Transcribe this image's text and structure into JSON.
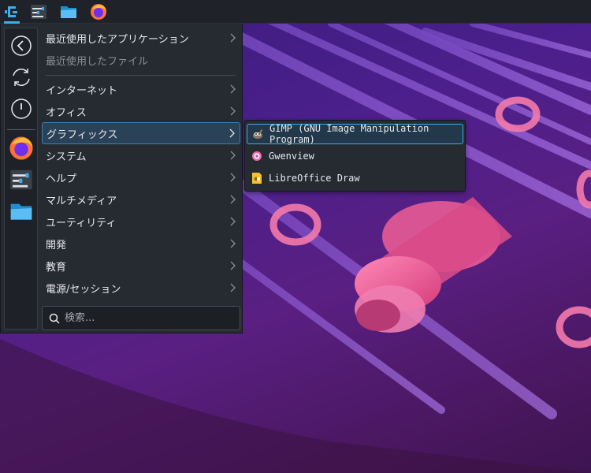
{
  "taskbar": {
    "launcher_icon": "application-launcher-icon",
    "apps": [
      {
        "name": "system-settings-icon"
      },
      {
        "name": "file-manager-icon"
      },
      {
        "name": "firefox-icon"
      }
    ]
  },
  "favorites": {
    "actions": [
      "back-icon",
      "refresh-icon",
      "power-icon"
    ],
    "apps": [
      "firefox-icon",
      "system-settings-icon",
      "file-manager-icon"
    ]
  },
  "menu": {
    "recent_apps": "最近使用したアプリケーション",
    "recent_files": "最近使用したファイル",
    "categories": [
      {
        "label": "インターネット"
      },
      {
        "label": "オフィス"
      },
      {
        "label": "グラフィックス",
        "selected": true
      },
      {
        "label": "システム"
      },
      {
        "label": "ヘルプ"
      },
      {
        "label": "マルチメディア"
      },
      {
        "label": "ユーティリティ"
      },
      {
        "label": "開発"
      },
      {
        "label": "教育"
      },
      {
        "label": "電源/セッション"
      }
    ]
  },
  "search": {
    "placeholder": "検索..."
  },
  "submenu": {
    "items": [
      {
        "label": "GIMP (GNU Image Manipulation Program)",
        "icon": "gimp-icon",
        "selected": true
      },
      {
        "label": "Gwenview",
        "icon": "gwenview-icon"
      },
      {
        "label": "LibreOffice Draw",
        "icon": "libreoffice-draw-icon"
      }
    ]
  },
  "colors": {
    "accent": "#3daee9",
    "panel_bg": "#1f2229",
    "menu_bg": "#262a31",
    "text": "#e6e8eb",
    "dim_text": "#8a8f96"
  }
}
